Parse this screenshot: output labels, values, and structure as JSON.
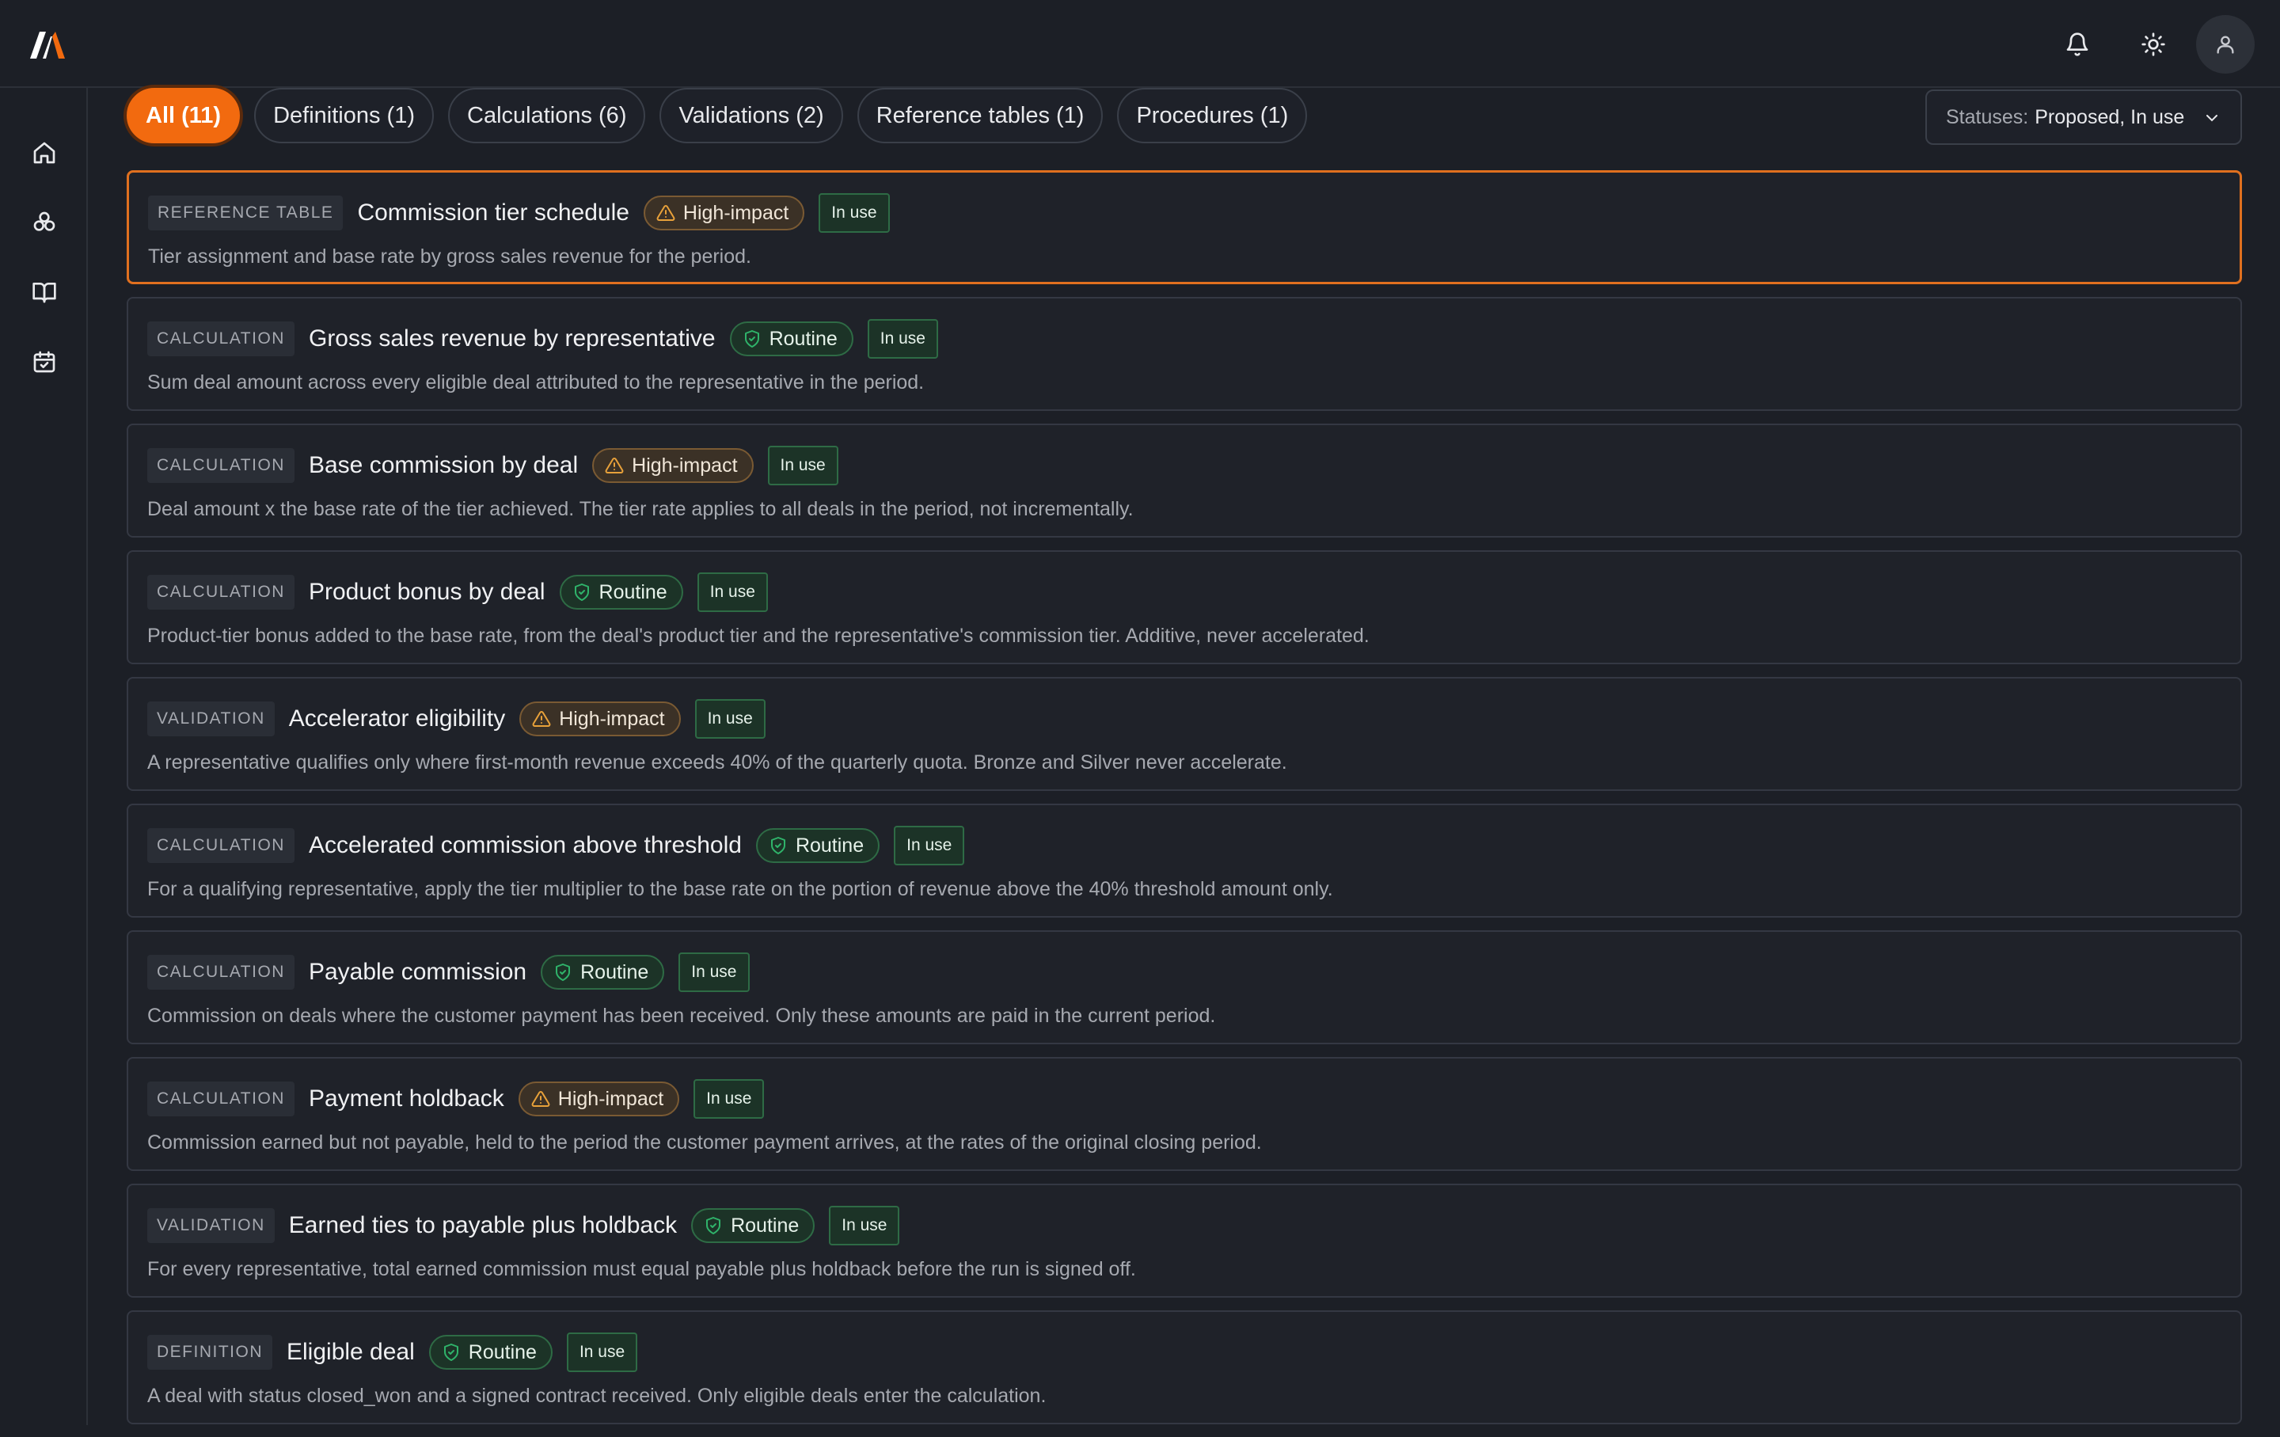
{
  "topbar": {
    "logo_icon": "brand-logo",
    "notification_icon": "bell-icon",
    "theme_icon": "sun-icon",
    "avatar_icon": "user-icon"
  },
  "rail": [
    "home-icon",
    "components-icon",
    "book-icon",
    "calendar-check-icon"
  ],
  "filters": {
    "chips": [
      {
        "label": "All (11)",
        "active": true
      },
      {
        "label": "Definitions (1)",
        "active": false
      },
      {
        "label": "Calculations (6)",
        "active": false
      },
      {
        "label": "Validations (2)",
        "active": false
      },
      {
        "label": "Reference tables (1)",
        "active": false
      },
      {
        "label": "Procedures (1)",
        "active": false
      }
    ],
    "status_select": {
      "label": "Statuses:",
      "value": "Proposed, In use"
    }
  },
  "colors": {
    "accent": "#f26a0f",
    "routine": "#2fb36a",
    "high_impact": "#e8a13a"
  },
  "cards": [
    {
      "type": "REFERENCE TABLE",
      "title": "Commission tier schedule",
      "impact": "High-impact",
      "impact_kind": "high",
      "status": "In use",
      "selected": true,
      "desc": "Tier assignment and base rate by gross sales revenue for the period."
    },
    {
      "type": "CALCULATION",
      "title": "Gross sales revenue by representative",
      "impact": "Routine",
      "impact_kind": "routine",
      "status": "In use",
      "desc": "Sum deal amount across every eligible deal attributed to the representative in the period."
    },
    {
      "type": "CALCULATION",
      "title": "Base commission by deal",
      "impact": "High-impact",
      "impact_kind": "high",
      "status": "In use",
      "desc": "Deal amount x the base rate of the tier achieved. The tier rate applies to all deals in the period, not incrementally."
    },
    {
      "type": "CALCULATION",
      "title": "Product bonus by deal",
      "impact": "Routine",
      "impact_kind": "routine",
      "status": "In use",
      "desc": "Product-tier bonus added to the base rate, from the deal's product tier and the representative's commission tier. Additive, never accelerated."
    },
    {
      "type": "VALIDATION",
      "title": "Accelerator eligibility",
      "impact": "High-impact",
      "impact_kind": "high",
      "status": "In use",
      "desc": "A representative qualifies only where first-month revenue exceeds 40% of the quarterly quota. Bronze and Silver never accelerate."
    },
    {
      "type": "CALCULATION",
      "title": "Accelerated commission above threshold",
      "impact": "Routine",
      "impact_kind": "routine",
      "status": "In use",
      "desc": "For a qualifying representative, apply the tier multiplier to the base rate on the portion of revenue above the 40% threshold amount only."
    },
    {
      "type": "CALCULATION",
      "title": "Payable commission",
      "impact": "Routine",
      "impact_kind": "routine",
      "status": "In use",
      "desc": "Commission on deals where the customer payment has been received. Only these amounts are paid in the current period."
    },
    {
      "type": "CALCULATION",
      "title": "Payment holdback",
      "impact": "High-impact",
      "impact_kind": "high",
      "status": "In use",
      "desc": "Commission earned but not payable, held to the period the customer payment arrives, at the rates of the original closing period."
    },
    {
      "type": "VALIDATION",
      "title": "Earned ties to payable plus holdback",
      "impact": "Routine",
      "impact_kind": "routine",
      "status": "In use",
      "desc": "For every representative, total earned commission must equal payable plus holdback before the run is signed off."
    },
    {
      "type": "DEFINITION",
      "title": "Eligible deal",
      "impact": "Routine",
      "impact_kind": "routine",
      "status": "In use",
      "desc": "A deal with status closed_won and a signed contract received. Only eligible deals enter the calculation."
    }
  ]
}
